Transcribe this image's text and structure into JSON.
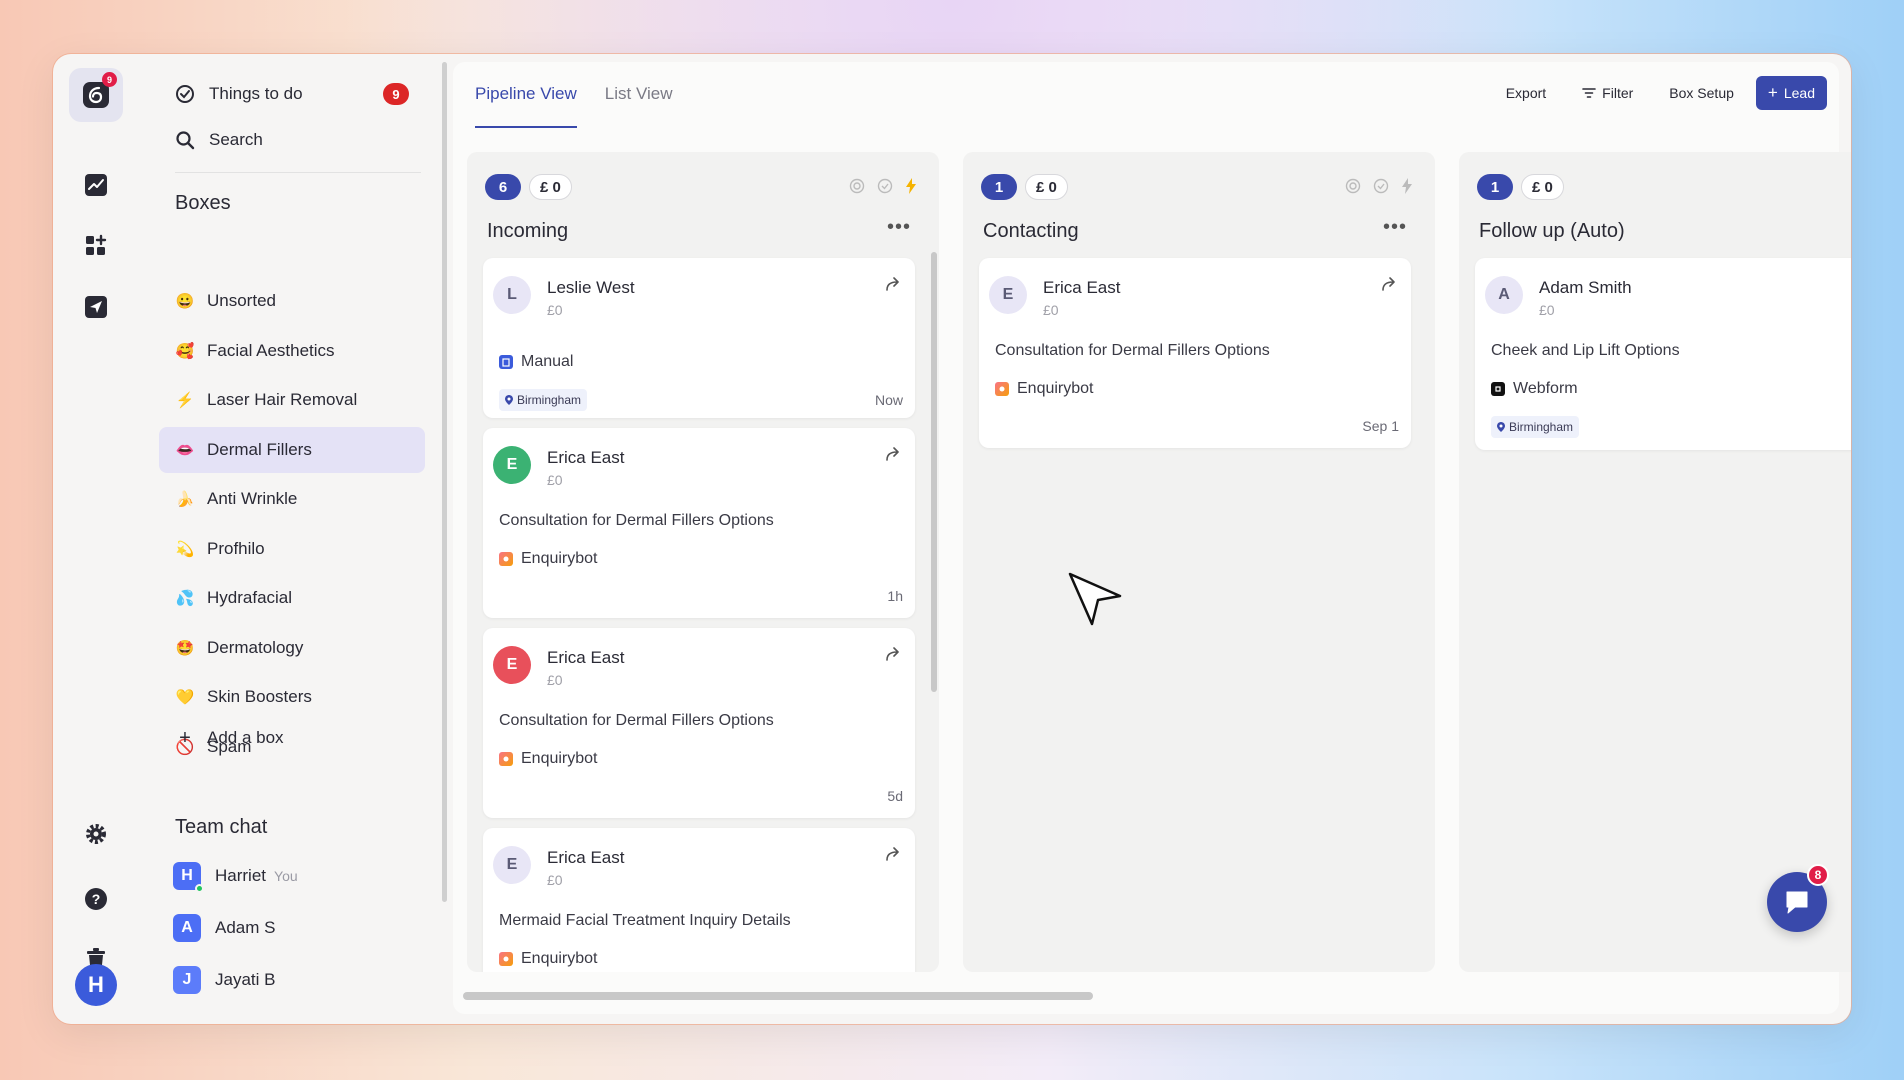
{
  "rail": {
    "logo_badge": "9",
    "user_initial": "H"
  },
  "sidebar": {
    "things_to_do": "Things to do",
    "things_count": "9",
    "search": "Search",
    "boxes_heading": "Boxes",
    "boxes": [
      {
        "emoji": "😀",
        "label": "Unsorted"
      },
      {
        "emoji": "🥰",
        "label": "Facial Aesthetics"
      },
      {
        "emoji": "⚡",
        "label": "Laser Hair Removal"
      },
      {
        "emoji": "👄",
        "label": "Dermal Fillers"
      },
      {
        "emoji": "🍌",
        "label": "Anti Wrinkle"
      },
      {
        "emoji": "💫",
        "label": "Profhilo"
      },
      {
        "emoji": "💦",
        "label": "Hydrafacial"
      },
      {
        "emoji": "🤩",
        "label": "Dermatology"
      },
      {
        "emoji": "💛",
        "label": "Skin Boosters"
      },
      {
        "emoji": "🚫",
        "label": "Spam"
      }
    ],
    "add_box": "Add a box",
    "team_chat_heading": "Team chat",
    "team": [
      {
        "initial": "H",
        "name": "Harriet",
        "you": "You",
        "color": "#4c6ef5"
      },
      {
        "initial": "A",
        "name": "Adam S",
        "color": "#4c6ef5"
      },
      {
        "initial": "J",
        "name": "Jayati B",
        "color": "#5c7cfa"
      }
    ]
  },
  "main": {
    "tabs": [
      "Pipeline View",
      "List View"
    ],
    "toolbar": {
      "export": "Export",
      "filter": "Filter",
      "box_setup": "Box Setup",
      "lead": "Lead"
    },
    "columns": [
      {
        "count": "6",
        "value": "£ 0",
        "title": "Incoming",
        "cards": [
          {
            "initial": "L",
            "name": "Leslie West",
            "value": "£0",
            "source": "Manual",
            "location": "Birmingham",
            "time": "Now"
          },
          {
            "initial": "E",
            "name": "Erica East",
            "value": "£0",
            "subject": "Consultation for Dermal Fillers Options",
            "source": "Enquirybot",
            "time": "1h"
          },
          {
            "initial": "E",
            "name": "Erica East",
            "value": "£0",
            "subject": "Consultation for Dermal Fillers Options",
            "source": "Enquirybot",
            "time": "5d"
          },
          {
            "initial": "E",
            "name": "Erica East",
            "value": "£0",
            "subject": "Mermaid Facial Treatment Inquiry Details",
            "source": "Enquirybot"
          }
        ]
      },
      {
        "count": "1",
        "value": "£ 0",
        "title": "Contacting",
        "cards": [
          {
            "initial": "E",
            "name": "Erica East",
            "value": "£0",
            "subject": "Consultation for Dermal Fillers Options",
            "source": "Enquirybot",
            "time": "Sep 1"
          }
        ]
      },
      {
        "count": "1",
        "value": "£ 0",
        "title": "Follow up (Auto)",
        "cards": [
          {
            "initial": "A",
            "name": "Adam Smith",
            "value": "£0",
            "subject": "Cheek and Lip Lift Options",
            "source": "Webform",
            "location": "Birmingham"
          }
        ]
      }
    ]
  },
  "chat_fab_badge": "8",
  "colors": {
    "accent": "#3949ab",
    "badge": "#dc2626",
    "active_box": "#e4e2f6"
  }
}
